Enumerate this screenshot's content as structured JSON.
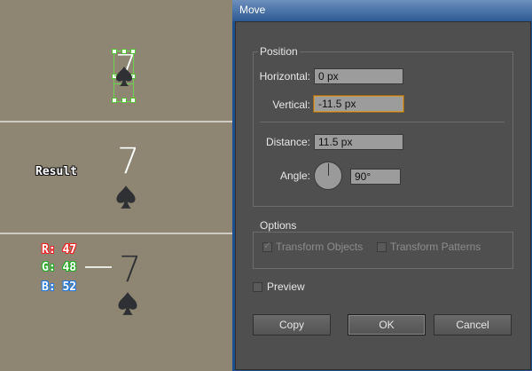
{
  "canvas": {
    "top_card": {
      "number": "7"
    },
    "result": {
      "label": "Result",
      "number": "7"
    },
    "color_card": {
      "number": "7"
    },
    "rgb": {
      "r": "R: 47",
      "g": "G: 48",
      "b": "B: 52"
    }
  },
  "dialog": {
    "title": "Move",
    "position": {
      "group_label": "Position",
      "horizontal_label": "Horizontal:",
      "horizontal_value": "0 px",
      "vertical_label": "Vertical:",
      "vertical_value": "-11.5 px",
      "distance_label": "Distance:",
      "distance_value": "11.5 px",
      "angle_label": "Angle:",
      "angle_value": "90°"
    },
    "options": {
      "group_label": "Options",
      "transform_objects": "Transform Objects",
      "transform_patterns": "Transform Patterns"
    },
    "preview_label": "Preview",
    "buttons": {
      "copy": "Copy",
      "ok": "OK",
      "cancel": "Cancel"
    }
  },
  "colors": {
    "canvas_bg": "#8e8573",
    "card_symbol_dark": "#2f3034",
    "selection": "#6bd64b",
    "dialog_bg": "#4f4f4f"
  }
}
